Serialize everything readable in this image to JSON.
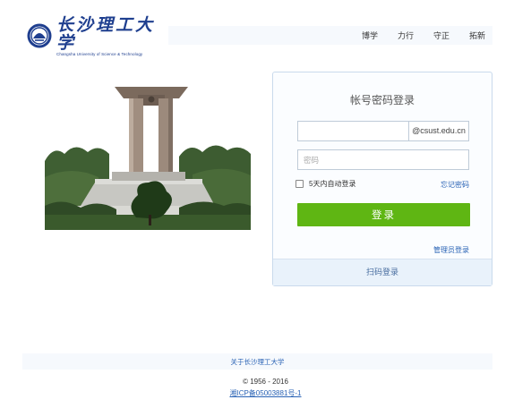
{
  "header": {
    "logo": {
      "name_cn": "长沙理工大学",
      "name_en": "Changsha University of Science & Technology"
    },
    "nav": [
      "博学",
      "力行",
      "守正",
      "拓新"
    ]
  },
  "login": {
    "title": "帐号密码登录",
    "username": {
      "value": "",
      "suffix": "@csust.edu.cn"
    },
    "password": {
      "placeholder": "密码"
    },
    "remember_label": "5天内自动登录",
    "forgot_label": "忘记密码",
    "submit_label": "登录",
    "admin_label": "管理员登录",
    "qr_label": "扫码登录"
  },
  "footer": {
    "about": "关于长沙理工大学",
    "copyright": "© 1956 - 2016",
    "icp": "湘ICP备05003881号-1"
  },
  "colors": {
    "accent_green": "#5fb613",
    "link_blue": "#2a63b5",
    "logo_blue": "#1f3f8f"
  }
}
